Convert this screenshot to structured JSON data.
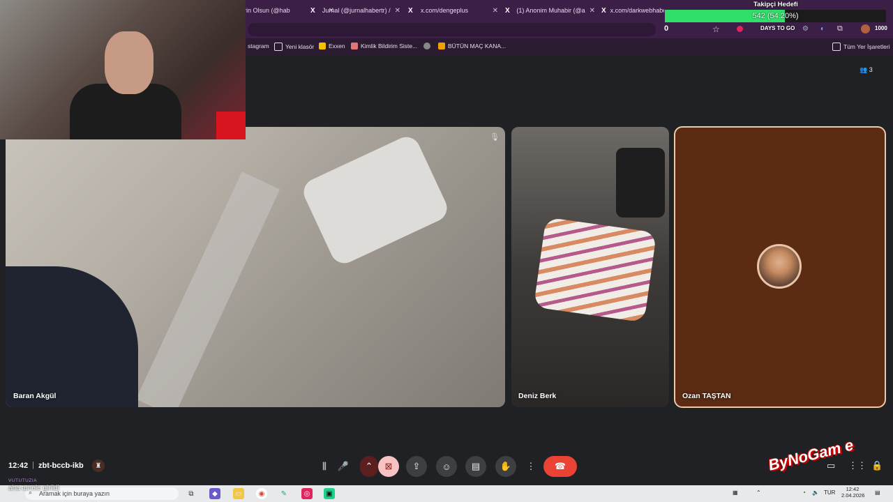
{
  "browser": {
    "tabs": [
      {
        "icon": "",
        "label": "rin Olsun (@hab"
      },
      {
        "icon": "X",
        "label": "Jurnal (@jurnalhabertr) / "
      },
      {
        "icon": "X",
        "label": "x.com/dengeplus"
      },
      {
        "icon": "X",
        "label": "(1) Anonim Muhabir (@a"
      },
      {
        "icon": "X",
        "label": "x.com/darkwebhaber"
      },
      {
        "icon": "X",
        "label": ""
      }
    ],
    "bookmarks": [
      {
        "label": "stagram",
        "icon": "instagram-icon"
      },
      {
        "label": "Yeni klasör",
        "icon": "folder-icon"
      },
      {
        "label": "Exxen",
        "icon": "exxen-icon"
      },
      {
        "label": "Kimlik Bildirim Siste...",
        "icon": "link-icon"
      },
      {
        "label": "",
        "icon": "globe-icon"
      },
      {
        "label": "BÜTÜN MAÇ KANA...",
        "icon": "bookmark-icon"
      }
    ],
    "all_bookmarks": "Tüm Yer İşaretleri"
  },
  "overlay": {
    "goal_title": "Takipçi Hedefi",
    "goal_text": "542 (54.20%)",
    "goal_fraction": 0.542,
    "goal_min": "0",
    "goal_max": "1000",
    "days_to_go": "DAYS TO GO"
  },
  "meet": {
    "participants_count": "3",
    "tiles": [
      {
        "name": "Baran Akgül",
        "muted": true
      },
      {
        "name": "Deniz Berk"
      },
      {
        "name": "Ozan TAŞTAN"
      }
    ],
    "time": "12:42",
    "meeting_code": "zbt-bccb-ikb"
  },
  "chat": {
    "user": "VUTUTUZIA",
    "message": "aha tunele girildi"
  },
  "taskbar": {
    "search_placeholder": "Aramak için buraya yazın",
    "lang": "TUR",
    "clock_time": "12:42",
    "clock_date": "2.04.2026"
  },
  "watermark": "ByNoGam e"
}
